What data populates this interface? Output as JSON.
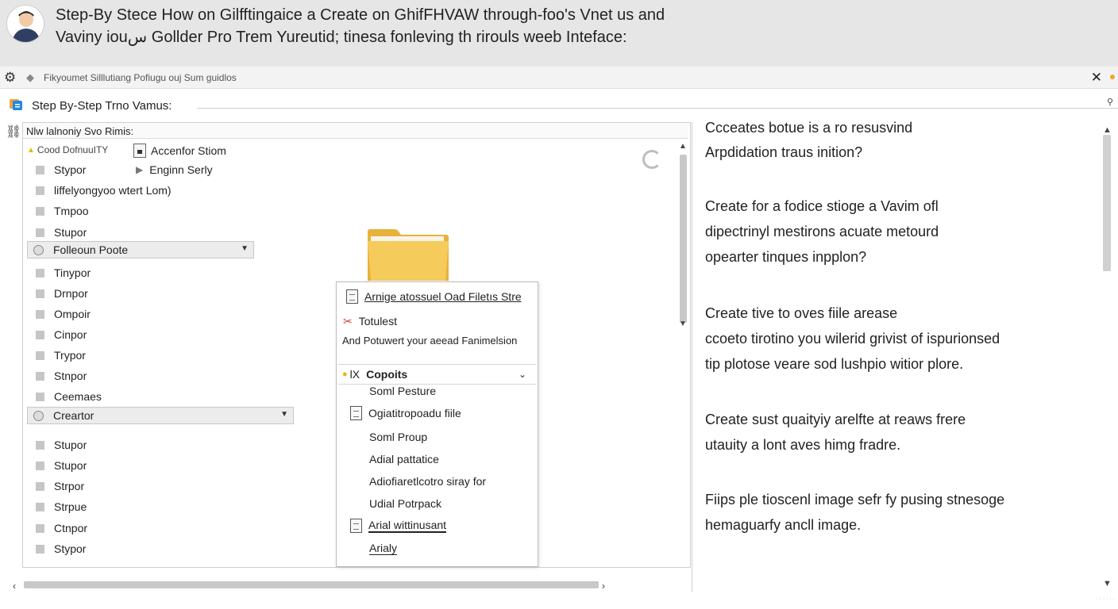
{
  "banner": {
    "line1": "Step-By Stece How on Gilfftingaice a Create on GhifFHVAW through-foo's Vnet us and",
    "line2": "Vaviny iouس Gollder Pro Trem Yureutid; tinesa fonleving th rirouls weeb Inteface:",
    "avatar_icon": "user-avatar-icon"
  },
  "titlebar": {
    "text": "Fikyoumet Silllutiang Pofiugu ouj Sum guidlos",
    "close": "✕",
    "gear_icon": "gear-icon",
    "tag_icon": "tag-icon"
  },
  "toolbar": {
    "title": "Step By-Step Trno Vamus:",
    "search_icon": "search-icon"
  },
  "left_panel": {
    "header": "Nlw lalnoniy Svo Rimis:",
    "row_good": "Cood DofnuuITY",
    "col2_row1": "Accenfor Stiom",
    "col2_row2": "Enginn Serly",
    "rows": [
      "Stypor",
      "liffelyongyoo wtert Lom)",
      "Tmpoo",
      "Stupor"
    ],
    "dropdown1": "Folleoun Poote",
    "rows2": [
      "Tinypor",
      "Drnpor",
      "Ompoir",
      "Cinpor",
      "Trypor",
      "Stnpor",
      "Ceemaes"
    ],
    "dropdown2": "Creartor",
    "rows3": [
      "Stupor",
      "Stupor",
      "Strpor",
      "Strpue",
      "Ctnpor",
      "Stypor"
    ]
  },
  "context_menu": {
    "item1": "Arnige atossuel Oad Filetıs Stre",
    "item2": "Totulest",
    "item3": "And Potuwert your aeead Fanimelsion",
    "section": "Copoits",
    "section_prefix": "lX",
    "items": [
      "Soml Pesture",
      "Ogiatitropoadu fiile",
      "Soml Proup",
      "Adial pattatice",
      "Adiofiaretlcotro siray for",
      "Udial Potrpack",
      "Arial wittinusant",
      "Arialy"
    ]
  },
  "right_pane": {
    "lines": [
      "Ccceates botue is a ro resusvind",
      "Arpdidation traus inition?",
      "Create for a fodice stioge a Vavim ofl",
      "dipectrinyl mestirons acuate metourd",
      "opearter tinques inpplon?",
      "Create tive to oves fiile arease",
      "ccoeto tirotino you wilerid grivist of ispurionsed",
      "tip plotose veare sod lushpio witior plore.",
      "Create sust quaityiy arelfte at reaws frere",
      "utauity a lont aves himg fradre.",
      "Fiips ple tioscenl image sefr fy pusing stnesoge",
      "hemaguarfy ancll image."
    ]
  },
  "colors": {
    "accent": "#1e88e5",
    "folder": "#f2c14e",
    "dot": "#f5a623"
  }
}
